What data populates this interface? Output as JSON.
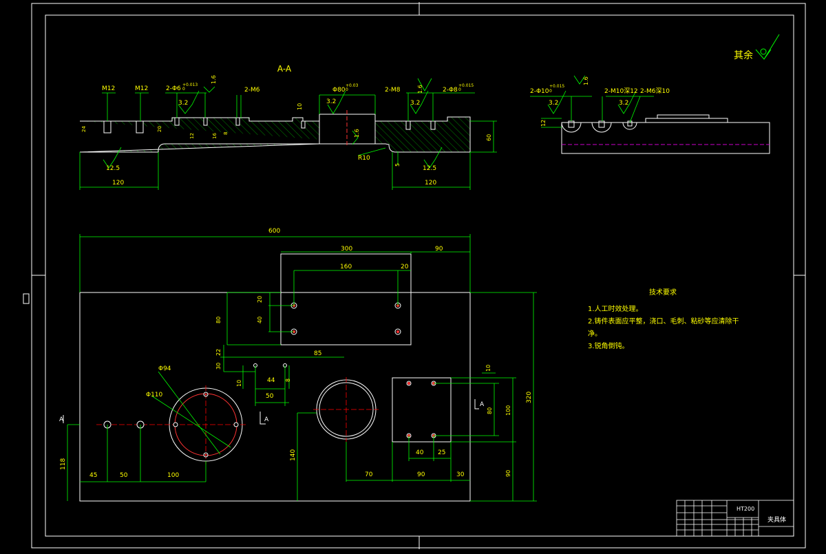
{
  "colors": {
    "background": "#000000",
    "frame": "#ffffff",
    "dimension": "#00ff00",
    "text": "#ffff00",
    "hatch": "#00cc00",
    "hole": "#ff3333",
    "centerline": "#ff0000",
    "hidden": "#cc00cc"
  },
  "section_view": {
    "label": "A-A",
    "callouts": {
      "m12_a": "M12",
      "m12_b": "M12",
      "phi6": "2-Φ6",
      "phi6_tol": "+0.013",
      "phi6_tol2": "0",
      "rough_16": "1.6",
      "m6": "2-M6",
      "phi80": "Φ80",
      "phi80_tol": "+0.03",
      "phi80_tol2": "0",
      "m8": "2-M8",
      "rough_16b": "1.6",
      "phi8": "2-Φ8",
      "phi8_tol": "+0.015",
      "phi8_tol2": "0",
      "rough_32a": "3.2",
      "rough_32b": "3.2",
      "rough_32c": "3.2",
      "dim_10": "10",
      "rough_16c": "1.6",
      "r10": "R10",
      "dim_5": "5",
      "rough_125a": "12.5",
      "rough_125b": "12.5",
      "dim_120a": "120",
      "dim_120b": "120",
      "dim_60": "60",
      "dim_24": "24",
      "dim_20": "20",
      "dim_12": "12",
      "dim_16": "16",
      "dim_8": "8"
    }
  },
  "side_view": {
    "phi10": "2-Φ10",
    "phi10_tol": "+0.015",
    "phi10_tol2": "0",
    "rough_16": "1.6",
    "m10": "2-M10深12",
    "m6": "2-M6深10",
    "rough_32a": "3.2",
    "rough_32b": "3.2",
    "dim_12": "12"
  },
  "plan_view": {
    "dims": {
      "d600": "600",
      "d300": "300",
      "d90a": "90",
      "d160": "160",
      "d20": "20",
      "d20b": "20",
      "d40": "40",
      "d80": "80",
      "d22": "22",
      "d30": "30",
      "d85": "85",
      "d10": "10",
      "d44": "44",
      "d8": "8",
      "d50": "50",
      "phi94": "Φ94",
      "phi110": "Φ110",
      "d118": "118",
      "d45": "45",
      "d50b": "50",
      "d100": "100",
      "d140": "140",
      "d70": "70",
      "d90b": "90",
      "d30b": "30",
      "d10b": "10",
      "d80b": "80",
      "d100b": "100",
      "d320": "320",
      "d40b": "40",
      "d25": "25",
      "d90c": "90"
    },
    "section_marks": {
      "a_left": "A",
      "a_mid": "A",
      "a_right": "A"
    }
  },
  "surface_note": "其余",
  "tech_requirements": {
    "title": "技术要求",
    "items": [
      "1.人工时效处理。",
      "2.铸件表面应平整，浇口、毛刺、粘砂等应清除干",
      "净。",
      "3.锐角倒钝。"
    ]
  },
  "title_block": {
    "material": "HT200",
    "part_name": "夹具体"
  }
}
